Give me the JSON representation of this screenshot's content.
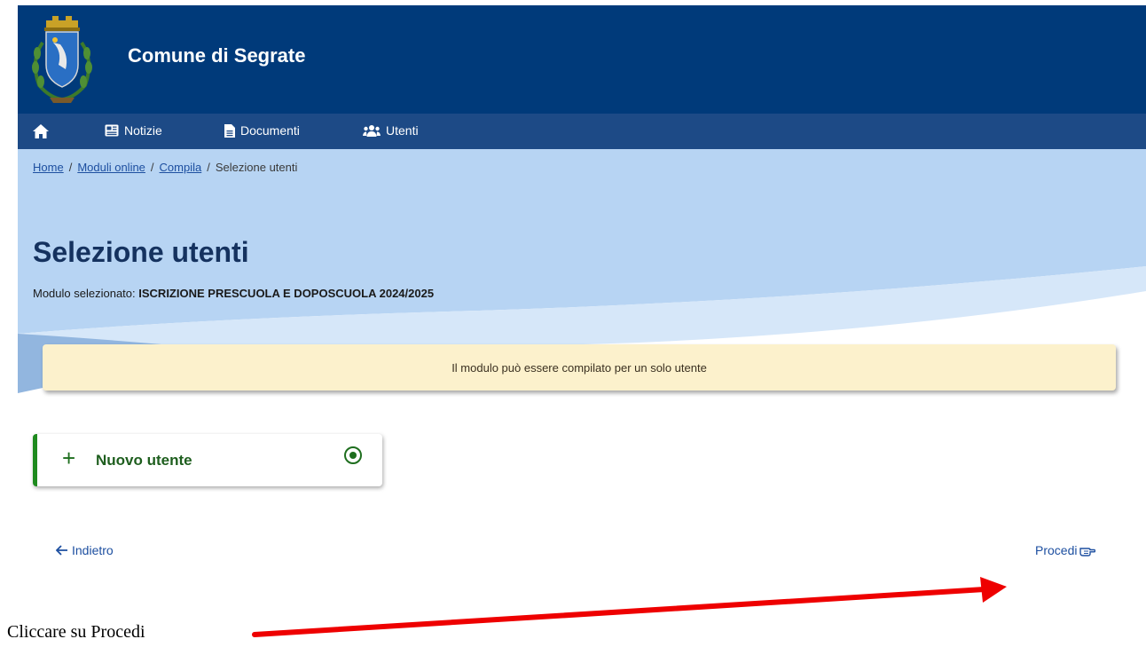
{
  "header": {
    "site_title": "Comune di Segrate",
    "logo_icon": "municipal-crest-icon",
    "background_color": "#003a7a"
  },
  "nav": {
    "home_icon": "home-icon",
    "items": [
      {
        "label": "Notizie",
        "icon": "newspaper-icon"
      },
      {
        "label": "Documenti",
        "icon": "document-icon"
      },
      {
        "label": "Utenti",
        "icon": "users-icon"
      }
    ],
    "background_color": "#1d4a86"
  },
  "breadcrumb": {
    "items": [
      "Home",
      "Moduli online",
      "Compila"
    ],
    "current": "Selezione utenti",
    "separator": "/"
  },
  "page": {
    "title": "Selezione utenti",
    "module_prefix": "Modulo selezionato:",
    "module_name": "ISCRIZIONE PRESCUOLA E DOPOSCUOLA 2024/2025"
  },
  "alert": {
    "text": "Il modulo può essere compilato per un solo utente",
    "background_color": "#fcf1cc"
  },
  "user_option": {
    "label": "Nuovo utente",
    "icon": "plus-icon",
    "selected": true,
    "accent_color": "#1e8a1e"
  },
  "actions": {
    "back_label": "Indietro",
    "back_icon": "arrow-left-icon",
    "proceed_label": "Procedi",
    "proceed_icon": "hand-pointing-icon"
  },
  "annotation": {
    "text": "Cliccare su Procedi",
    "arrow_color": "#ee0000"
  }
}
